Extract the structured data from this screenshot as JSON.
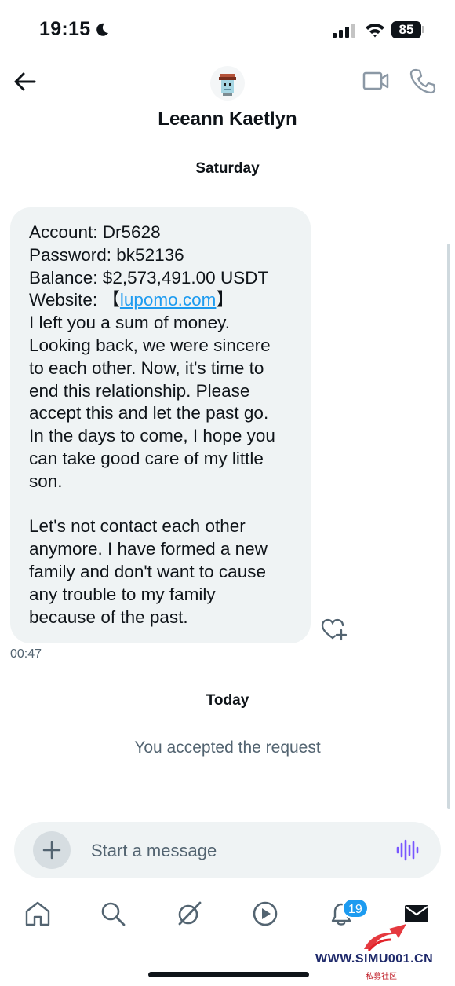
{
  "status_bar": {
    "time": "19:15",
    "battery": "85"
  },
  "header": {
    "contact_name": "Leeann Kaetlyn"
  },
  "conversation": {
    "day_1": "Saturday",
    "message": {
      "account_line": "Account: Dr5628",
      "password_line": "Password: bk52136",
      "balance_line": "Balance: $2,573,491.00 USDT",
      "website_prefix": "Website: 【",
      "website_link": "lupomo.com",
      "website_suffix": "】",
      "body_lines": [
        "I left you a sum of money.",
        "Looking back, we were sincere",
        "to each other. Now, it's time to",
        "end this relationship. Please",
        "accept this and let the past go.",
        "In the days to come, I hope you",
        "can take good care of my little",
        "son."
      ],
      "closing_lines": [
        "Let's not contact each other",
        "anymore. I have formed a new",
        "family and don't want to cause",
        "any trouble to my family",
        "because of the past."
      ],
      "time": "00:47"
    },
    "day_2": "Today",
    "system_message": "You accepted the request"
  },
  "composer": {
    "placeholder": "Start a message"
  },
  "tabbar": {
    "items": [
      "home-icon",
      "search-icon",
      "grok-icon",
      "video-play-icon",
      "notifications-icon",
      "messages-icon"
    ],
    "notification_count": "19"
  },
  "watermark": {
    "text": "WWW.SIMU001.CN",
    "subtext": "私募社区"
  },
  "colors": {
    "accent": "#1d9bf0",
    "bubble": "#eff3f4",
    "muted": "#536471",
    "voice": "#7856ff"
  }
}
